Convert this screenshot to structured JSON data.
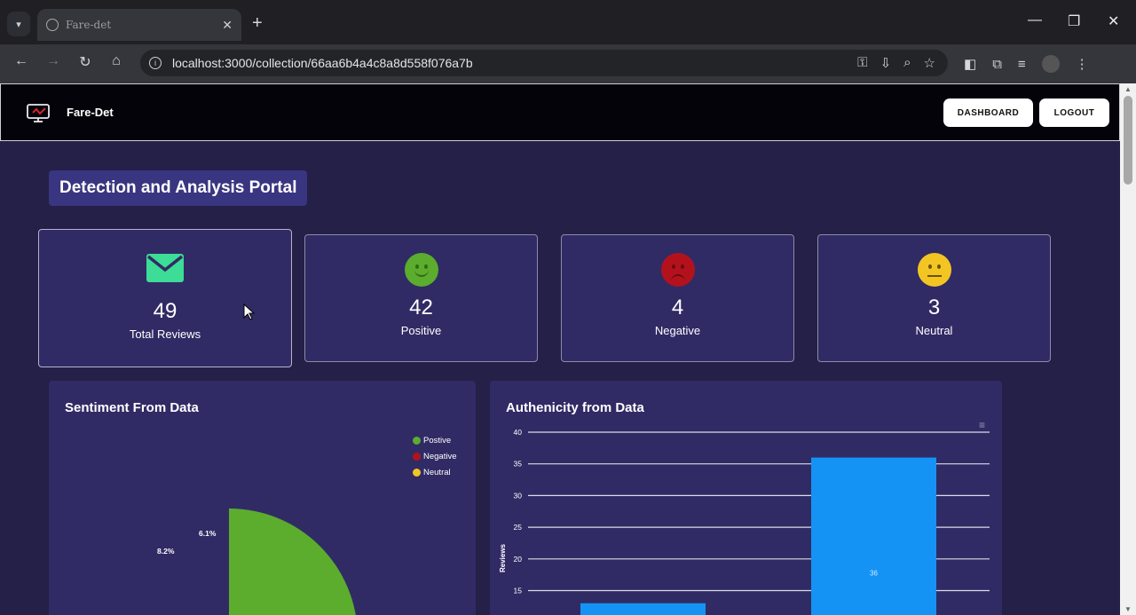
{
  "browser": {
    "tab_title": "Fare-det",
    "url": "localhost:3000/collection/66aa6b4a4c8a8d558f076a7b"
  },
  "app": {
    "brand": "Fare-Det",
    "dashboard_label": "DASHBOARD",
    "logout_label": "LOGOUT",
    "portal_title": "Detection and Analysis Portal"
  },
  "stats": {
    "total": {
      "value": "49",
      "label": "Total Reviews",
      "icon": "envelope-icon",
      "color": "#3ddc97"
    },
    "positive": {
      "value": "42",
      "label": "Positive",
      "icon": "smile-face-icon",
      "color": "#5cac2e"
    },
    "negative": {
      "value": "4",
      "label": "Negative",
      "icon": "sad-face-icon",
      "color": "#b3121d"
    },
    "neutral": {
      "value": "3",
      "label": "Neutral",
      "icon": "neutral-face-icon",
      "color": "#f2c523"
    }
  },
  "panels": {
    "sentiment_title": "Sentiment From Data",
    "authenticity_title": "Authenicity from Data"
  },
  "chart_data": [
    {
      "type": "pie",
      "title": "Sentiment From Data",
      "labels": [
        "Postive",
        "Negative",
        "Neutral"
      ],
      "values": [
        42,
        4,
        3
      ],
      "data_labels": [
        "",
        "8.2%",
        "6.1%"
      ],
      "colors": [
        "#5cac2e",
        "#b3121d",
        "#f2c523"
      ],
      "legend": "right"
    },
    {
      "type": "bar",
      "title": "Authenicity from Data",
      "ylabel": "Reviews",
      "yticks": [
        15,
        20,
        25,
        30,
        35,
        40
      ],
      "ylim": [
        15,
        40
      ],
      "values": [
        13,
        36
      ],
      "data_labels": [
        "",
        "36"
      ],
      "colors": [
        "#1493f5",
        "#1493f5"
      ],
      "grid": true
    }
  ]
}
